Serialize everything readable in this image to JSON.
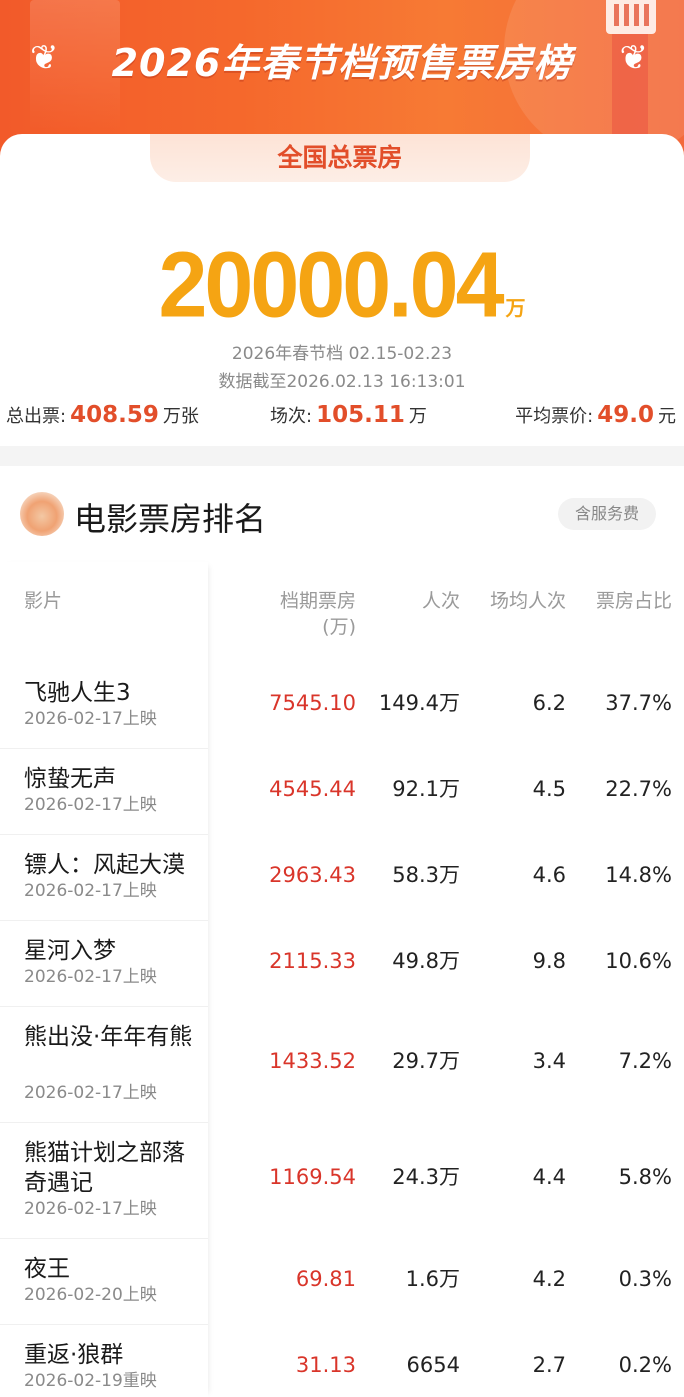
{
  "banner": {
    "title": "2026年春节档预售票房榜",
    "laurel_left": "⸜",
    "laurel_right": "⸝"
  },
  "summary": {
    "tab_label": "全国总票房",
    "total_value": "20000.04",
    "total_unit": "万",
    "period": "2026年春节档 02.15-02.23",
    "data_as_of": "数据截至2026.02.13 16:13:01",
    "tickets_label": "总出票:",
    "tickets_value": "408.59",
    "tickets_unit": "万张",
    "shows_label": "场次:",
    "shows_value": "105.11",
    "shows_unit": "万",
    "avg_price_label": "平均票价:",
    "avg_price_value": "49.0",
    "avg_price_unit": "元"
  },
  "ranking": {
    "title": "电影票房排名",
    "fee_badge": "含服务费",
    "headers": {
      "film": "影片",
      "box_office": "档期票房",
      "box_office_unit": "(万)",
      "people": "人次",
      "avg_per_show": "场均人次",
      "share": "票房占比"
    },
    "rows": [
      {
        "name": "飞驰人生3",
        "date": "2026-02-17上映",
        "box": "7545.10",
        "people": "149.4万",
        "avg": "6.2",
        "share": "37.7%"
      },
      {
        "name": "惊蛰无声",
        "date": "2026-02-17上映",
        "box": "4545.44",
        "people": "92.1万",
        "avg": "4.5",
        "share": "22.7%"
      },
      {
        "name": "镖人：风起大漠",
        "date": "2026-02-17上映",
        "box": "2963.43",
        "people": "58.3万",
        "avg": "4.6",
        "share": "14.8%"
      },
      {
        "name": "星河入梦",
        "date": "2026-02-17上映",
        "box": "2115.33",
        "people": "49.8万",
        "avg": "9.8",
        "share": "10.6%"
      },
      {
        "name": "熊出没·年年有熊",
        "date": "2026-02-17上映",
        "box": "1433.52",
        "people": "29.7万",
        "avg": "3.4",
        "share": "7.2%"
      },
      {
        "name": "熊猫计划之部落奇遇记",
        "date": "2026-02-17上映",
        "box": "1169.54",
        "people": "24.3万",
        "avg": "4.4",
        "share": "5.8%"
      },
      {
        "name": "夜王",
        "date": "2026-02-20上映",
        "box": "69.81",
        "people": "1.6万",
        "avg": "4.2",
        "share": "0.3%"
      },
      {
        "name": "重返·狼群",
        "date": "2026-02-19重映",
        "box": "31.13",
        "people": "6654",
        "avg": "2.7",
        "share": "0.2%"
      }
    ]
  },
  "colors": {
    "accent": "#e24e2a",
    "total": "#f5a413",
    "box_value": "#d9352a",
    "banner": "#f5682c"
  }
}
